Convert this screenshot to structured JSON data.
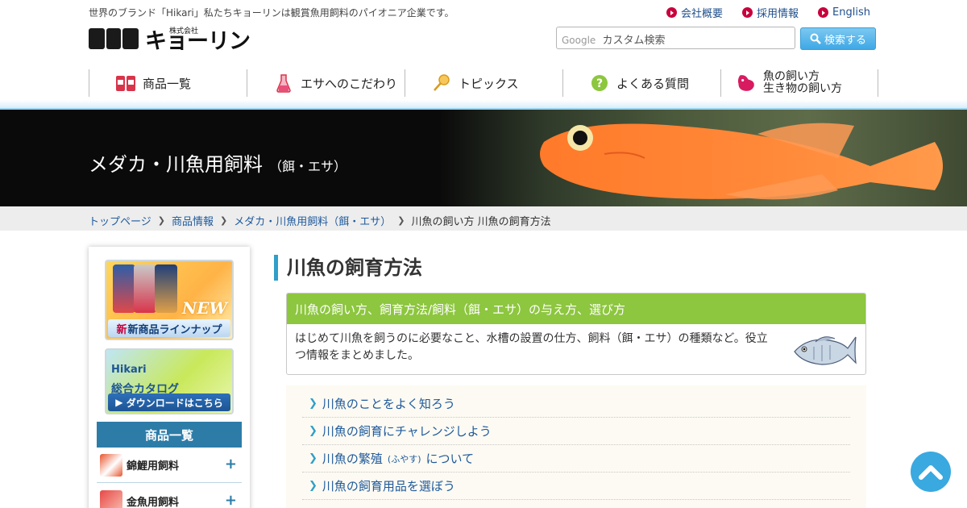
{
  "header": {
    "tagline": "世界のブランド「Hikari」私たちキョーリンは観賞魚用飼料のパイオニア企業です。",
    "logo_text": "キョーリン",
    "logo_sub": "株式会社",
    "top_links": [
      "会社概要",
      "採用情報",
      "English"
    ],
    "search": {
      "brand": "Google",
      "placeholder": "カスタム検索",
      "button": "検索する"
    }
  },
  "nav": {
    "items": [
      {
        "label": "商品一覧",
        "icon": "products-icon"
      },
      {
        "label": "エサへのこだわり",
        "icon": "flask-icon"
      },
      {
        "label": "トピックス",
        "icon": "pin-icon"
      },
      {
        "label": "よくある質問",
        "icon": "question-icon"
      },
      {
        "line1": "魚の飼い方",
        "line2": "生き物の飼い方",
        "icon": "fish-care-icon"
      }
    ]
  },
  "hero": {
    "title": "メダカ・川魚用飼料",
    "subtitle": "（餌・エサ）"
  },
  "breadcrumb": [
    "トップページ",
    "商品情報",
    "メダカ・川魚用飼料（餌・エサ）",
    "川魚の飼い方 川魚の飼育方法"
  ],
  "sidebar": {
    "banner_new": {
      "label": "新商品ラインナップ",
      "badge": "NEW",
      "new_char": "新"
    },
    "banner_catalog": {
      "brand": "Hikari",
      "title": "総合カタログ",
      "label": "ダウンロードはこちら"
    },
    "heading": "商品一覧",
    "items": [
      {
        "label": "錦鯉用飼料",
        "toggle": "+"
      },
      {
        "label": "金魚用飼料",
        "toggle": "+"
      }
    ]
  },
  "main": {
    "title": "川魚の飼育方法",
    "intro": {
      "heading": "川魚の飼い方、飼育方法/飼料（餌・エサ）の与え方、選び方",
      "body": "はじめて川魚を飼うのに必要なこと、水槽の設置の仕方、飼料（餌・エサ）の種類など。役立つ情報をまとめました。"
    },
    "links": [
      {
        "label": "川魚のことをよく知ろう"
      },
      {
        "label": "川魚の飼育にチャレンジしよう"
      },
      {
        "label": "川魚の繁殖",
        "ruby": "(ふやす)",
        "suffix": "について"
      },
      {
        "label": "川魚の飼育用品を選ぼう"
      }
    ]
  },
  "colors": {
    "accent": "#2f9fc8",
    "green": "#8dc63f",
    "link": "#1f5a9c",
    "red": "#c8003c"
  }
}
